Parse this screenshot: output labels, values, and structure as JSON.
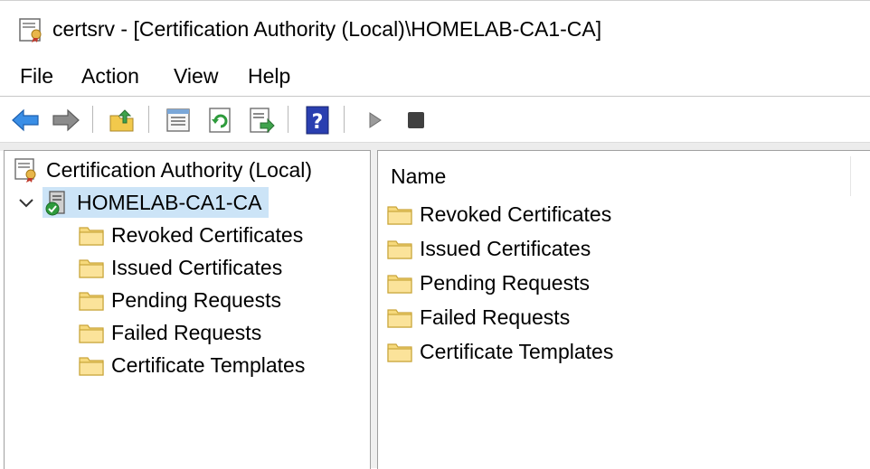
{
  "window": {
    "title": "certsrv - [Certification Authority (Local)\\HOMELAB-CA1-CA]"
  },
  "menu": [
    "File",
    "Action",
    "View",
    "Help"
  ],
  "toolbar": {
    "buttons": [
      "back-icon",
      "forward-icon",
      "up-one-level-icon",
      "properties-icon",
      "refresh-icon",
      "export-list-icon",
      "help-icon",
      "start-service-icon",
      "stop-service-icon"
    ]
  },
  "tree": {
    "root": "Certification Authority (Local)",
    "ca": "HOMELAB-CA1-CA",
    "children": [
      "Revoked Certificates",
      "Issued Certificates",
      "Pending Requests",
      "Failed Requests",
      "Certificate Templates"
    ]
  },
  "list": {
    "column": "Name",
    "items": [
      "Revoked Certificates",
      "Issued Certificates",
      "Pending Requests",
      "Failed Requests",
      "Certificate Templates"
    ]
  },
  "colors": {
    "selection": "#cce4f7",
    "folder": "#f6d97c",
    "folder_edge": "#c9a53a",
    "help_blue": "#2a3fb0",
    "arrow_blue": "#2f7fd6"
  }
}
